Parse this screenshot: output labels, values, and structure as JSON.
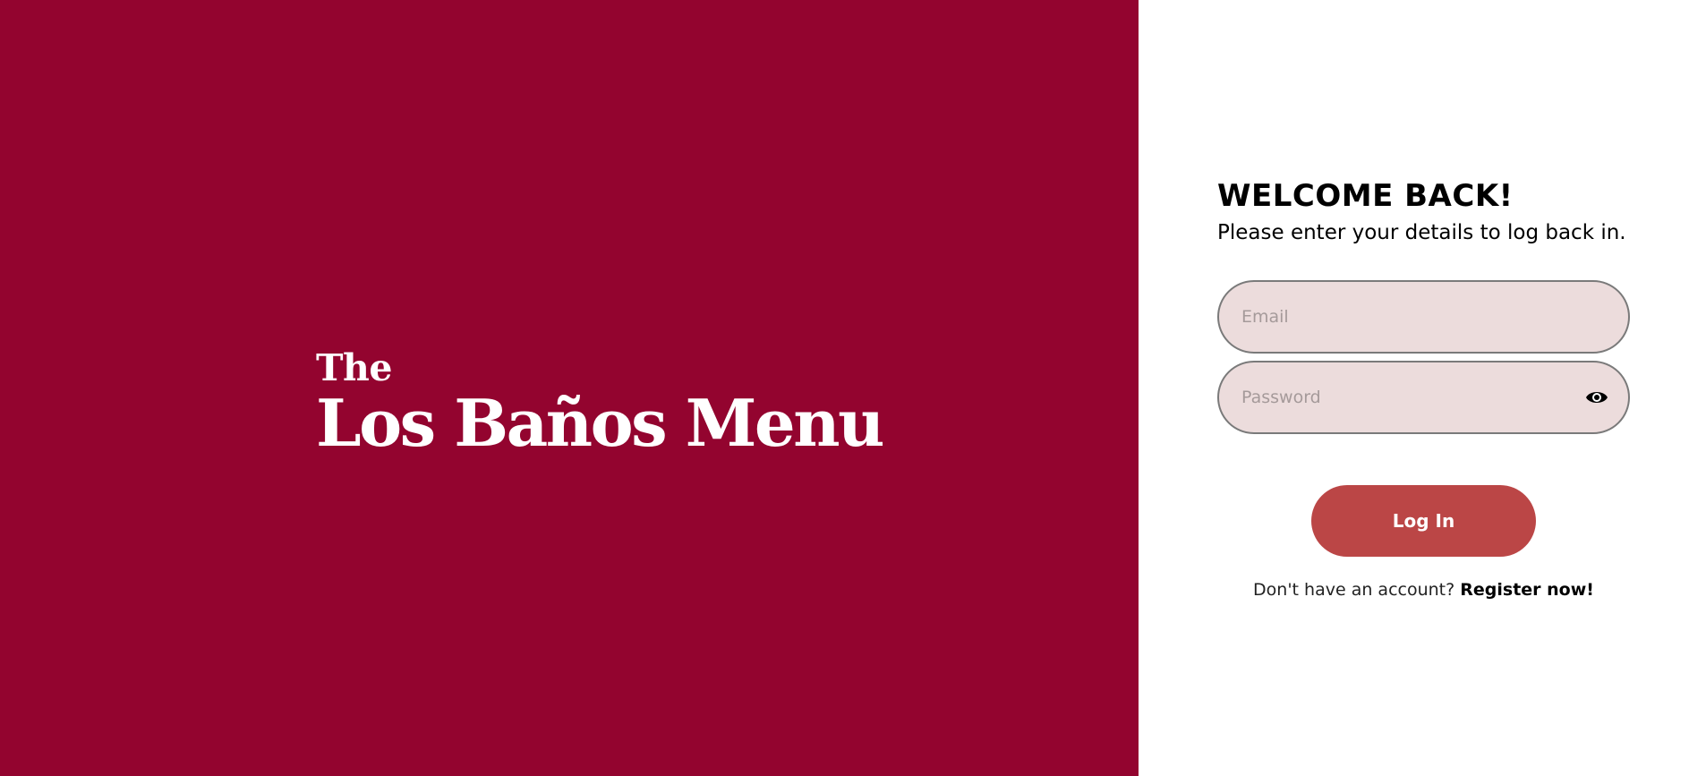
{
  "brand": {
    "the": "The",
    "name": "Los Baños Menu",
    "background_color": "#93042f"
  },
  "login": {
    "title": "WELCOME BACK!",
    "subtitle": "Please enter your details to log back in.",
    "email_placeholder": "Email",
    "password_placeholder": "Password",
    "password_toggle_icon": "eye-icon",
    "login_label": "Log In",
    "login_button_color": "#bb4646",
    "field_background": "#ecdcdc",
    "register_prompt": "Don't have an account?",
    "register_link": "Register now!"
  }
}
